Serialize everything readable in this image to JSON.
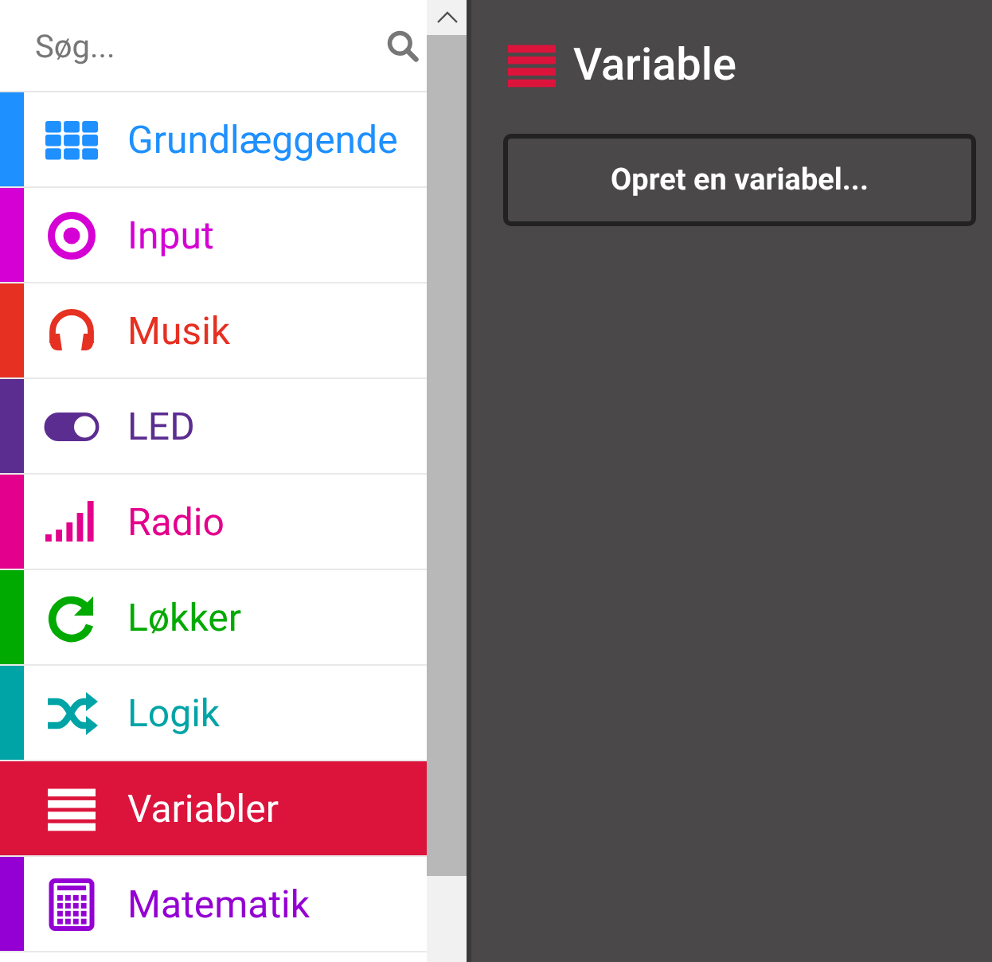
{
  "search": {
    "placeholder": "Søg..."
  },
  "categories": [
    {
      "label": "Grundlæggende",
      "kind": "grid",
      "color": "#1e90ff",
      "selected": false
    },
    {
      "label": "Input",
      "kind": "target",
      "color": "#d400d4",
      "selected": false
    },
    {
      "label": "Musik",
      "kind": "headphones",
      "color": "#e63022",
      "selected": false
    },
    {
      "label": "LED",
      "kind": "toggle",
      "color": "#5c2d91",
      "selected": false
    },
    {
      "label": "Radio",
      "kind": "signal",
      "color": "#e3008c",
      "selected": false
    },
    {
      "label": "Løkker",
      "kind": "refresh",
      "color": "#00aa00",
      "selected": false
    },
    {
      "label": "Logik",
      "kind": "shuffle",
      "color": "#00a4a6",
      "selected": false
    },
    {
      "label": "Variabler",
      "kind": "list",
      "color": "#dc143c",
      "selected": true
    },
    {
      "label": "Matematik",
      "kind": "calculator",
      "color": "#9400d3",
      "selected": false
    }
  ],
  "flyout": {
    "title": "Variable",
    "button": "Opret en variabel..."
  }
}
